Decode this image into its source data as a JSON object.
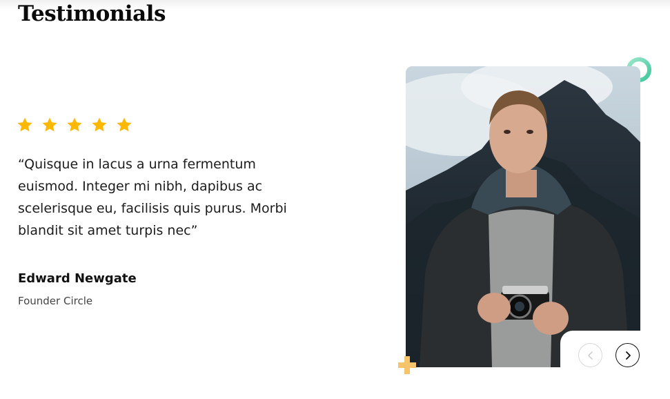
{
  "section": {
    "title": "Testimonials"
  },
  "testimonial": {
    "rating": 5,
    "rating_max": 5,
    "quote": "“Quisque in lacus a urna fermentum euismod. Integer mi nibh, dapibus ac scelerisque eu, facilisis quis purus. Morbi blandit sit amet turpis nec”",
    "author_name": "Edward Newgate",
    "author_role": "Founder Circle"
  },
  "navigation": {
    "prev_icon": "chevron-left-icon",
    "next_icon": "chevron-right-icon",
    "prev_enabled": false,
    "next_enabled": true
  },
  "colors": {
    "star": "#FFB800",
    "ring_decoration": "#6FD8B4",
    "plus_decoration": "#F7C46C",
    "text": "#1c1c1c"
  }
}
